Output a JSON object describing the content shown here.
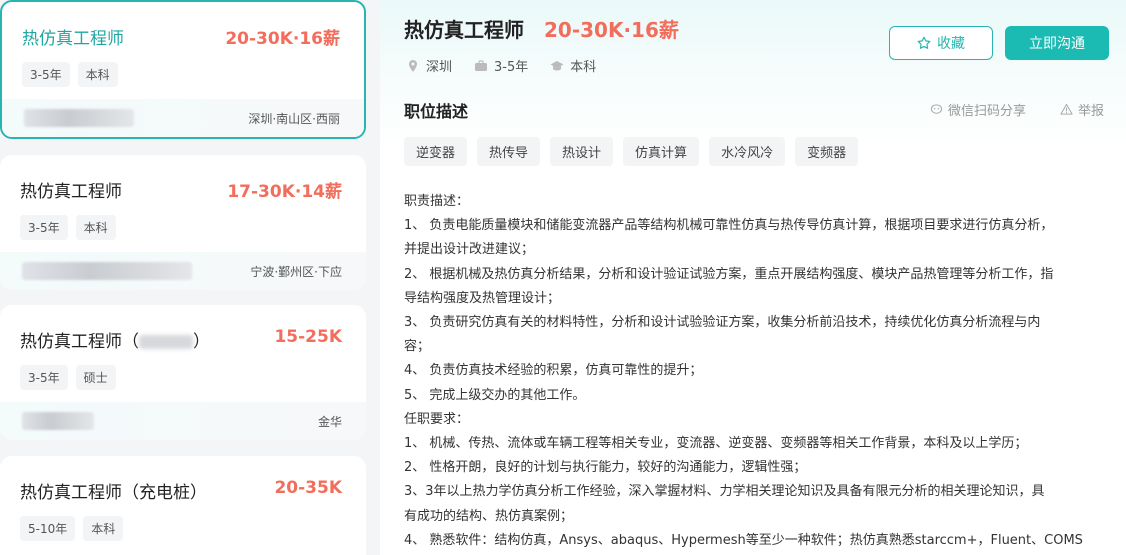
{
  "job_list": [
    {
      "title": "热仿真工程师",
      "salary": "20-30K·16薪",
      "tags": [
        "3-5年",
        "本科"
      ],
      "location": "深圳·南山区·西丽"
    },
    {
      "title": "热仿真工程师",
      "salary": "17-30K·14薪",
      "tags": [
        "3-5年",
        "本科"
      ],
      "location": "宁波·鄞州区·下应"
    },
    {
      "title": "热仿真工程师（",
      "title_suffix": "）",
      "salary": "15-25K",
      "tags": [
        "3-5年",
        "硕士"
      ],
      "location": "金华"
    },
    {
      "title": "热仿真工程师（充电桩）",
      "salary": "20-35K",
      "tags": [
        "5-10年",
        "本科"
      ],
      "location": ""
    }
  ],
  "detail": {
    "title": "热仿真工程师",
    "salary": "20-30K·16薪",
    "city": "深圳",
    "experience": "3-5年",
    "degree": "本科",
    "fav_label": "收藏",
    "chat_label": "立即沟通",
    "section_title": "职位描述",
    "share_label": "微信扫码分享",
    "report_label": "举报",
    "skills": [
      "逆变器",
      "热传导",
      "热设计",
      "仿真计算",
      "水冷风冷",
      "变频器"
    ],
    "description": [
      "职责描述：",
      " 1、 负责电能质量模块和储能变流器产品等结构机械可靠性仿真与热传导仿真计算，根据项目要求进行仿真分析，",
      "并提出设计改进建议；",
      " 2、 根据机械及热仿真分析结果，分析和设计验证试验方案，重点开展结构强度、模块产品热管理等分析工作，指",
      "导结构强度及热管理设计；",
      " 3、 负责研究仿真有关的材料特性，分析和设计试验验证方案，收集分析前沿技术，持续优化仿真分析流程与内",
      "容；",
      " 4、 负责仿真技术经验的积累，仿真可靠性的提升；",
      " 5、 完成上级交办的其他工作。",
      "任职要求：",
      " 1、 机械、传热、流体或车辆工程等相关专业，变流器、逆变器、变频器等相关工作背景，本科及以上学历；",
      " 2、 性格开朗，良好的计划与执行能力，较好的沟通能力，逻辑性强；",
      " 3、3年以上热力学仿真分析工作经验，深入掌握材料、力学相关理论知识及具备有限元分析的相关理论知识，具",
      "有成功的结构、热仿真案例；",
      " 4、 熟悉软件：结构仿真，Ansys、abaqus、Hypermesh等至少一种软件；热仿真熟悉starccm+，Fluent、COMS"
    ]
  }
}
